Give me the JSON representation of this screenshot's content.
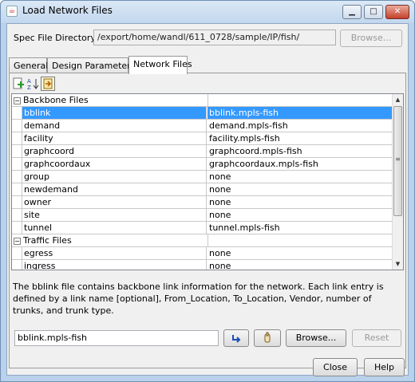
{
  "window": {
    "title": "Load Network Files",
    "icon": "java-cup-icon"
  },
  "spec": {
    "label": "Spec File Directory:",
    "value": "/export/home/wandl/611_0728/sample/IP/fish/",
    "browse_label": "Browse..."
  },
  "tabs": [
    {
      "label": "General",
      "active": false
    },
    {
      "label": "Design Parameters",
      "active": false
    },
    {
      "label": "Network Files",
      "active": true
    }
  ],
  "toolbar": {
    "add_icon": "add-file-icon",
    "sort_icon": "sort-az-icon",
    "load_icon": "load-icon"
  },
  "table": {
    "groups": [
      {
        "name": "Backbone Files",
        "rows": [
          {
            "type": "bblink",
            "file": "bblink.mpls-fish",
            "selected": true
          },
          {
            "type": "demand",
            "file": "demand.mpls-fish"
          },
          {
            "type": "facility",
            "file": "facility.mpls-fish"
          },
          {
            "type": "graphcoord",
            "file": "graphcoord.mpls-fish"
          },
          {
            "type": "graphcoordaux",
            "file": "graphcoordaux.mpls-fish"
          },
          {
            "type": "group",
            "file": "none"
          },
          {
            "type": "newdemand",
            "file": "none"
          },
          {
            "type": "owner",
            "file": "none"
          },
          {
            "type": "site",
            "file": "none"
          },
          {
            "type": "tunnel",
            "file": "tunnel.mpls-fish"
          }
        ]
      },
      {
        "name": "Traffic Files",
        "rows": [
          {
            "type": "egress",
            "file": "none"
          },
          {
            "type": "ingress",
            "file": "none"
          }
        ]
      }
    ]
  },
  "description": "The bblink file contains backbone link information for the network. Each link entry is defined by a link name [optional], From_Location, To_Location, Vendor, number of trunks, and trunk type.",
  "file_edit": {
    "value": "bblink.mpls-fish",
    "browse_label": "Browse...",
    "reset_label": "Reset"
  },
  "footer": {
    "close_label": "Close",
    "help_label": "Help"
  }
}
